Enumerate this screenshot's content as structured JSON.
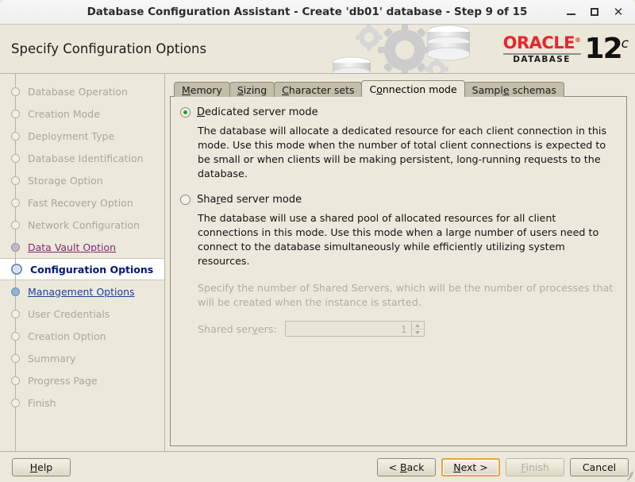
{
  "window": {
    "title": "Database Configuration Assistant - Create 'db01' database - Step 9 of 15",
    "minimize_label": "Minimize",
    "maximize_label": "Maximize",
    "close_label": "Close"
  },
  "header": {
    "page_title": "Specify Configuration Options",
    "brand": "ORACLE",
    "brand_trademark": "®",
    "product": "DATABASE",
    "version": "12",
    "version_suffix": "c"
  },
  "sidebar": {
    "items": [
      {
        "label": "Database Operation",
        "state": "pending"
      },
      {
        "label": "Creation Mode",
        "state": "pending"
      },
      {
        "label": "Deployment Type",
        "state": "pending"
      },
      {
        "label": "Database Identification",
        "state": "pending"
      },
      {
        "label": "Storage Option",
        "state": "pending"
      },
      {
        "label": "Fast Recovery Option",
        "state": "pending"
      },
      {
        "label": "Network Configuration",
        "state": "pending"
      },
      {
        "label": "Data Vault Option",
        "state": "done"
      },
      {
        "label": "Configuration Options",
        "state": "active"
      },
      {
        "label": "Management Options",
        "state": "next"
      },
      {
        "label": "User Credentials",
        "state": "pending"
      },
      {
        "label": "Creation Option",
        "state": "pending"
      },
      {
        "label": "Summary",
        "state": "pending"
      },
      {
        "label": "Progress Page",
        "state": "pending"
      },
      {
        "label": "Finish",
        "state": "pending"
      }
    ]
  },
  "tabs": [
    {
      "label": "Memory",
      "mnemonic": "M",
      "active": false
    },
    {
      "label": "Sizing",
      "mnemonic": "S",
      "active": false
    },
    {
      "label": "Character sets",
      "mnemonic": "C",
      "active": false
    },
    {
      "label": "Connection mode",
      "mnemonic": "o",
      "active": true
    },
    {
      "label": "Sample schemas",
      "mnemonic": "e",
      "active": false
    }
  ],
  "connection_mode": {
    "dedicated": {
      "label": "Dedicated server mode",
      "mnemonic": "D",
      "selected": true,
      "description": "The database will allocate a dedicated resource for each client connection in this mode. Use this mode when the number of total client connections is expected to be small or when clients will be making persistent, long-running requests to the database."
    },
    "shared": {
      "label": "Shared server mode",
      "mnemonic": "r",
      "selected": false,
      "description": "The database will use a shared pool of allocated resources for all client connections in this mode.  Use this mode when a large number of users need to connect to the database simultaneously while efficiently utilizing system resources.",
      "hint": "Specify the number of Shared Servers, which will be the number of processes that will be created when the instance is started.",
      "spinner_label": "Shared servers:",
      "spinner_mnemonic": "v",
      "spinner_value": "1",
      "spinner_disabled": true
    }
  },
  "footer": {
    "help": "Help",
    "help_mnemonic": "H",
    "back": "< Back",
    "back_mnemonic": "B",
    "next": "Next >",
    "next_mnemonic": "N",
    "finish": "Finish",
    "finish_mnemonic": "F",
    "cancel": "Cancel"
  },
  "colors": {
    "panel_bg": "#ece9dc",
    "tab_inactive": "#c3beaa",
    "accent_focus": "#e8a33d",
    "oracle_red": "#e8262c",
    "active_nav_text": "#00177a",
    "visited_nav_text": "#86286e",
    "link_nav_text": "#1a3f9e",
    "radio_dot": "#1ea01e",
    "disabled_text": "#b0ada0"
  }
}
